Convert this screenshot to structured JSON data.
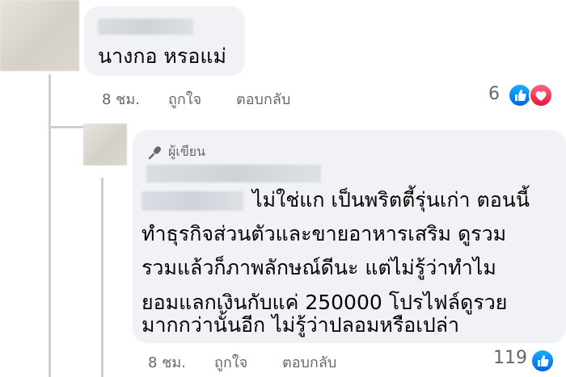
{
  "comment": {
    "text": "นางกอ หรอแม่",
    "time": "8 ชม.",
    "like_action": "ถูกใจ",
    "reply_action": "ตอบกลับ",
    "reaction_count": "6",
    "reaction_icons": [
      "like-icon",
      "love-icon"
    ]
  },
  "reply": {
    "author_badge": "ผู้เขียน",
    "badge_icon": "microphone-icon",
    "lines": [
      "ไม่ใช่แก เป็นพริตตี้รุ่นเก่า ตอนนี้",
      "ทำธุรกิจส่วนตัวและขายอาหารเสริม ดูรวม",
      "รวมแล้วก็ภาพลักษณ์ดีนะ แต่ไม่รู้ว่าทำไม",
      "ยอมแลกเงินกับแค่ 250000  โปรไฟล์ดูรวย",
      "มากกว่านั้นอีก ไม่รู้ว่าปลอมหรือเปล่า"
    ],
    "time": "8 ชม.",
    "like_action": "ถูกใจ",
    "reply_action": "ตอบกลับ",
    "reaction_count": "119",
    "reaction_icons": [
      "like-icon"
    ]
  },
  "colors": {
    "bubble": "#f0f2f5",
    "meta_text": "#65676b",
    "like_blue": "#0866ff",
    "love_red": "#f33e58"
  }
}
